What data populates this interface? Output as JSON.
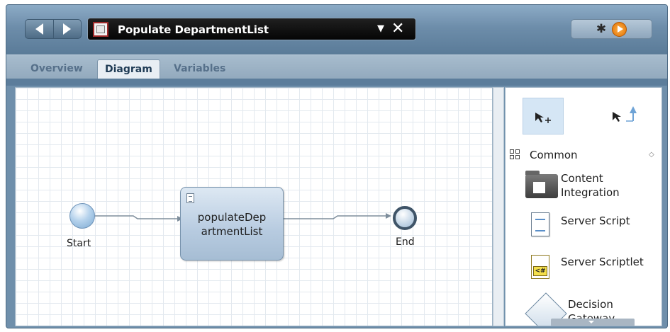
{
  "window": {
    "title": "Populate DepartmentList"
  },
  "tabs": [
    {
      "label": "Overview",
      "active": false
    },
    {
      "label": "Diagram",
      "active": true
    },
    {
      "label": "Variables",
      "active": false
    }
  ],
  "diagram": {
    "start_label": "Start",
    "task_label": "populateDep\nartmentList",
    "end_label": "End"
  },
  "palette": {
    "category": "Common",
    "items": [
      {
        "label": "Content\nIntegration",
        "icon": "content-integration-icon"
      },
      {
        "label": "Server Script",
        "icon": "server-script-icon"
      },
      {
        "label": "Server Scriptlet",
        "icon": "server-scriptlet-icon"
      },
      {
        "label": "Decision Gateway",
        "icon": "decision-gateway-icon"
      }
    ]
  },
  "colors": {
    "title_bar": "#6d8daa",
    "tab_bar": "#a7bccd",
    "canvas_grid": "#e3e9ef",
    "task_fill": "#b7cbe0",
    "run_button": "#e06f00"
  }
}
